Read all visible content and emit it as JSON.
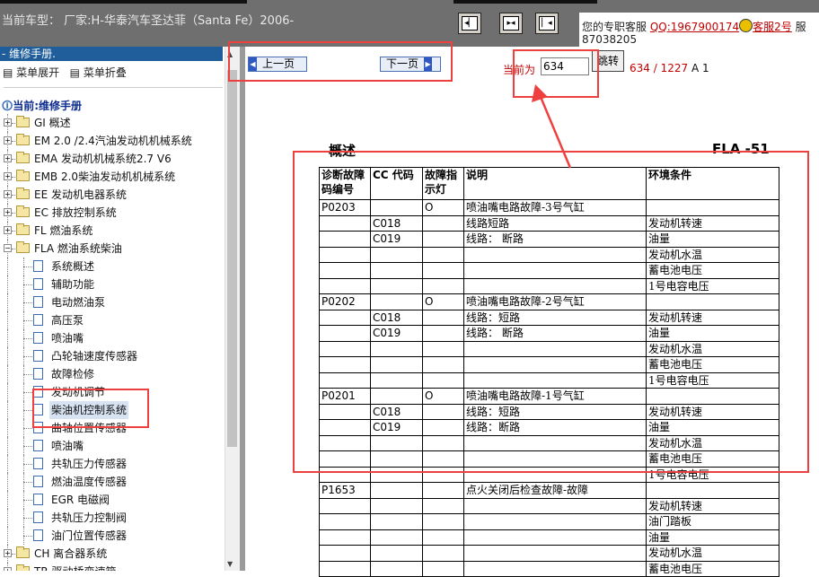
{
  "topbar": {
    "car_model": "当前车型：  厂家:H-华泰汽车圣达菲（Santa Fe）2006-",
    "buttons": [
      "prev-frame",
      "split-frame",
      "next-frame"
    ],
    "service_prefix": "您的专职客服",
    "qq_label": "QQ:1967900174",
    "kf_label": "客服2号",
    "service_suffix": "服",
    "phone": "87038205"
  },
  "left": {
    "header": "- 维修手册.",
    "expand_all": "菜单展开",
    "collapse_all": "菜单折叠",
    "current_manual": "当前:维修手册",
    "tree": [
      {
        "label": "GI 概述",
        "type": "folder",
        "expanded": false
      },
      {
        "label": "EM 2.0 /2.4汽油发动机机械系统",
        "type": "folder",
        "expanded": false
      },
      {
        "label": "EMA 发动机机械系统2.7 V6",
        "type": "folder",
        "expanded": false
      },
      {
        "label": "EMB 2.0柴油发动机机械系统",
        "type": "folder",
        "expanded": false
      },
      {
        "label": "EE 发动机电器系统",
        "type": "folder",
        "expanded": false
      },
      {
        "label": "EC 排放控制系统",
        "type": "folder",
        "expanded": false
      },
      {
        "label": "FL 燃油系统",
        "type": "folder",
        "expanded": false
      },
      {
        "label": "FLA 燃油系统柴油",
        "type": "folder",
        "expanded": true
      },
      {
        "label": "系统概述",
        "type": "doc"
      },
      {
        "label": "辅助功能",
        "type": "doc"
      },
      {
        "label": "电动燃油泵",
        "type": "doc"
      },
      {
        "label": "高压泵",
        "type": "doc"
      },
      {
        "label": "喷油嘴",
        "type": "doc"
      },
      {
        "label": "凸轮轴速度传感器",
        "type": "doc"
      },
      {
        "label": "故障检修",
        "type": "doc"
      },
      {
        "label": "发动机调节",
        "type": "doc"
      },
      {
        "label": "柴油机控制系统",
        "type": "doc",
        "selected": true
      },
      {
        "label": "曲轴位置传感器",
        "type": "doc"
      },
      {
        "label": "喷油嘴",
        "type": "doc"
      },
      {
        "label": "共轨压力传感器",
        "type": "doc"
      },
      {
        "label": "燃油温度传感器",
        "type": "doc"
      },
      {
        "label": "EGR 电磁阀",
        "type": "doc"
      },
      {
        "label": "共轨压力控制阀",
        "type": "doc"
      },
      {
        "label": "油门位置传感器",
        "type": "doc"
      },
      {
        "label": "CH 离合器系统",
        "type": "folder",
        "expanded": false
      },
      {
        "label": "TR 驱动桥变速箱",
        "type": "folder",
        "expanded": false
      }
    ]
  },
  "nav": {
    "prev": "上一页",
    "next": "下一页",
    "current_label": "当前为",
    "page_value": "634",
    "jump": "跳转",
    "page_count": "634 / 1227",
    "a1": "A 1"
  },
  "doc": {
    "title": "概述",
    "page_id": "FLA -51",
    "columns": [
      "诊断故障码编号",
      "CC 代码",
      "故障指示灯",
      "说明",
      "环境条件"
    ],
    "rows": [
      [
        "P0203",
        "",
        "O",
        "喷油嘴电路故障-3号气缸",
        ""
      ],
      [
        "",
        "C018",
        "",
        "线路短路",
        "发动机转速"
      ],
      [
        "",
        "C019",
        "",
        "线路：  断路",
        "油量"
      ],
      [
        "",
        "",
        "",
        "",
        "发动机水温"
      ],
      [
        "",
        "",
        "",
        "",
        "蓄电池电压"
      ],
      [
        "",
        "",
        "",
        "",
        "1号电容电压"
      ],
      [
        "P0202",
        "",
        "O",
        "喷油嘴电路故障-2号气缸",
        ""
      ],
      [
        "",
        "C018",
        "",
        "线路：短路",
        "发动机转速"
      ],
      [
        "",
        "C019",
        "",
        "线路：  断路",
        "油量"
      ],
      [
        "",
        "",
        "",
        "",
        "发动机水温"
      ],
      [
        "",
        "",
        "",
        "",
        "蓄电池电压"
      ],
      [
        "",
        "",
        "",
        "",
        "1号电容电压"
      ],
      [
        "P0201",
        "",
        "O",
        "喷油嘴电路故障-1号气缸",
        ""
      ],
      [
        "",
        "C018",
        "",
        "线路：短路",
        "发动机转速"
      ],
      [
        "",
        "C019",
        "",
        "线路：断路",
        "油量"
      ],
      [
        "",
        "",
        "",
        "",
        "发动机水温"
      ],
      [
        "",
        "",
        "",
        "",
        "蓄电池电压"
      ],
      [
        "",
        "",
        "",
        "",
        "1号电容电压"
      ],
      [
        "P1653",
        "",
        "",
        "点火关闭后检查故障-故障",
        ""
      ],
      [
        "",
        "",
        "",
        "",
        "发动机转速"
      ],
      [
        "",
        "",
        "",
        "",
        "油门踏板"
      ],
      [
        "",
        "",
        "",
        "",
        "油量"
      ],
      [
        "",
        "",
        "",
        "",
        "发动机水温"
      ],
      [
        "",
        "",
        "",
        "",
        "蓄电池电压"
      ]
    ]
  },
  "colors": {
    "annotation": "#ef4040",
    "accent": "#1f5e9b",
    "link": "#c00000"
  }
}
